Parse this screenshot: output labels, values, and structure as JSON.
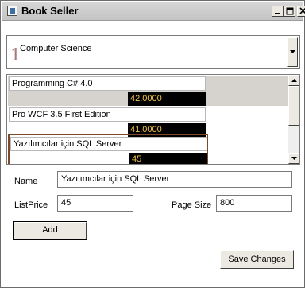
{
  "window": {
    "title": "Book Seller"
  },
  "category_combo": {
    "number": "1",
    "value": "Computer Science"
  },
  "books": [
    {
      "name": "Programming C# 4.0",
      "price": "42.0000"
    },
    {
      "name": "Pro WCF 3.5 First Edition",
      "price": "41.0000"
    },
    {
      "name": "Yazılımcılar için SQL Server",
      "price": "45"
    }
  ],
  "form": {
    "name_label": "Name",
    "name_value": "Yazılımcılar için SQL Server",
    "listprice_label": "ListPrice",
    "listprice_value": "45",
    "pagesize_label": "Page Size",
    "pagesize_value": "800",
    "add_label": "Add",
    "save_label": "Save Changes"
  }
}
